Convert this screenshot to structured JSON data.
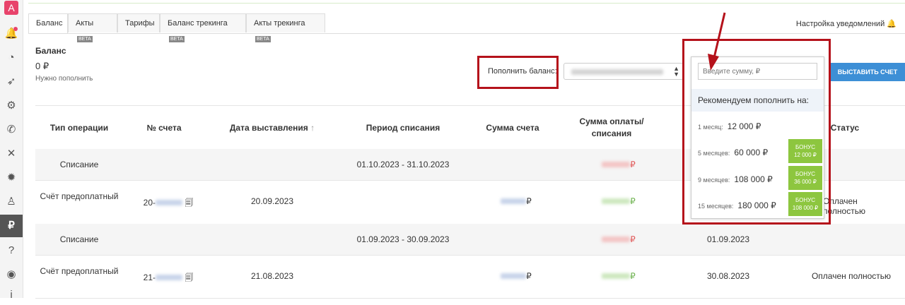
{
  "sidebar": {
    "logo": "A",
    "items": [
      {
        "name": "bell-icon",
        "glyph": "🔔",
        "dot": true
      },
      {
        "name": "speedometer-icon",
        "glyph": "◔"
      },
      {
        "name": "rocket-icon",
        "glyph": "➶"
      },
      {
        "name": "gears-icon",
        "glyph": "⚙"
      },
      {
        "name": "phone-icon",
        "glyph": "✆"
      },
      {
        "name": "tools-icon",
        "glyph": "✕"
      },
      {
        "name": "gear-icon",
        "glyph": "✹"
      },
      {
        "name": "person-icon",
        "glyph": "♙"
      },
      {
        "name": "ruble-icon",
        "glyph": "₽",
        "active": true
      },
      {
        "name": "help-icon",
        "glyph": "?"
      },
      {
        "name": "user-icon",
        "glyph": "◉"
      },
      {
        "name": "info-icon",
        "glyph": "i"
      }
    ]
  },
  "tabs": [
    {
      "label": "Баланс",
      "active": true,
      "beta": false
    },
    {
      "label": "Акты",
      "beta": true
    },
    {
      "label": "Тарифы",
      "beta": false
    },
    {
      "label": "Баланс трекинга",
      "beta": true
    },
    {
      "label": "Акты трекинга",
      "beta": true
    }
  ],
  "beta_label": "BETA",
  "notifications_link": "Настройка уведомлений",
  "balance": {
    "title": "Баланс",
    "amount": "0 ₽",
    "hint": "Нужно пополнить"
  },
  "topup": {
    "label": "Пополнить баланс:",
    "invoice_button": "ВЫСТАВИТЬ СЧЕТ"
  },
  "table": {
    "headers": [
      "Тип операции",
      "№ счета",
      "Дата выставления",
      "Период списания",
      "Сумма счета",
      "Сумма оплаты/списания",
      "",
      "Статус"
    ],
    "sort_icon": "↑",
    "rows": [
      {
        "type": "Списание",
        "invoice": "",
        "date": "",
        "period": "01.10.2023 - 31.10.2023",
        "sum": "",
        "pay": "₽",
        "pay_color": "red",
        "paid_date": "",
        "status": ""
      },
      {
        "type": "Счёт предоплатный",
        "invoice": "20-",
        "date": "20.09.2023",
        "period": "",
        "sum": "₽",
        "pay": "₽",
        "pay_color": "green",
        "paid_date": "",
        "status": "Оплачен полностью"
      },
      {
        "type": "Списание",
        "invoice": "",
        "date": "",
        "period": "01.09.2023 - 30.09.2023",
        "sum": "",
        "pay": "₽",
        "pay_color": "red",
        "paid_date": "01.09.2023",
        "status": ""
      },
      {
        "type": "Счёт предоплатный",
        "invoice": "21-",
        "date": "21.08.2023",
        "period": "",
        "sum": "₽",
        "pay": "₽",
        "pay_color": "green",
        "paid_date": "30.08.2023",
        "status": "Оплачен полностью"
      }
    ]
  },
  "dropdown": {
    "placeholder": "Введите сумму, ₽",
    "recommend_title": "Рекомендуем пополнить на:",
    "options": [
      {
        "months": "1 месяц:",
        "amount": "12 000 ₽",
        "bonus": ""
      },
      {
        "months": "5 месяцев:",
        "amount": "60 000 ₽",
        "bonus_label": "БОНУС",
        "bonus": "12 000 ₽"
      },
      {
        "months": "9 месяцев:",
        "amount": "108 000 ₽",
        "bonus_label": "БОНУС",
        "bonus": "36 000 ₽"
      },
      {
        "months": "15 месяцев:",
        "amount": "180 000 ₽",
        "bonus_label": "БОНУС",
        "bonus": "108 000 ₽"
      }
    ]
  },
  "colors": {
    "accent": "#3d8fd6",
    "highlight": "#b5121b",
    "bonus": "#8dc63f",
    "brand": "#e8436b"
  }
}
